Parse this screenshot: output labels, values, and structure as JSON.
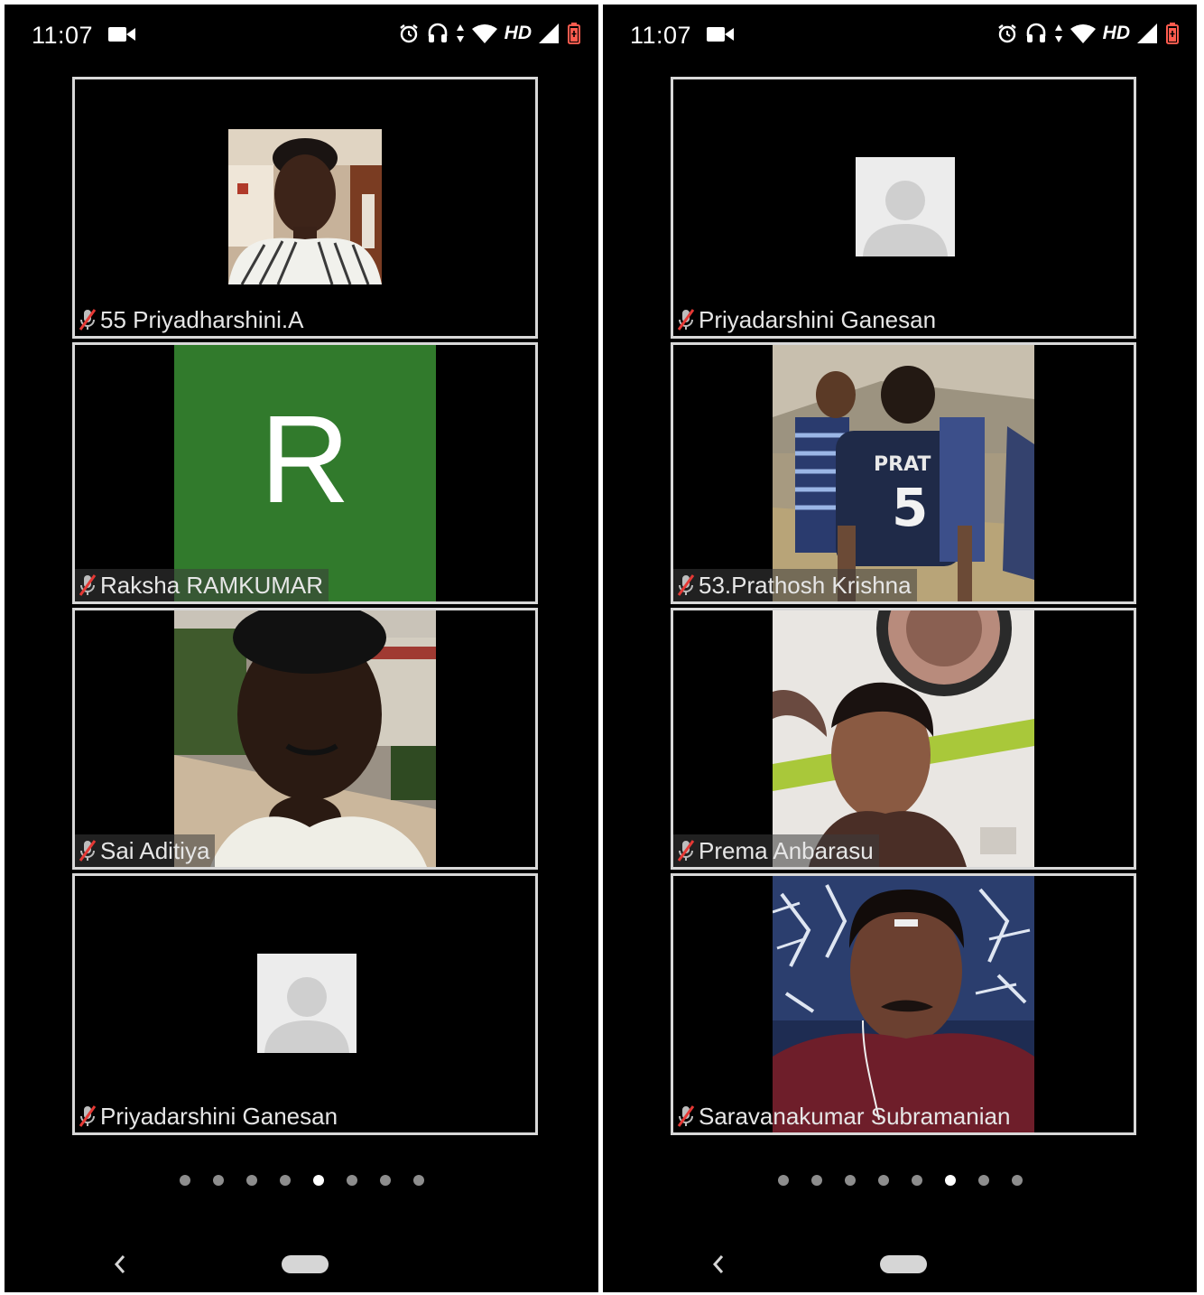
{
  "colors": {
    "screen": "#000000",
    "tile_border": "#d8d8d8",
    "initial_avatar": "#317a2c",
    "page_dot": "#8d8d8d",
    "page_dot_active": "#ffffff",
    "mic_muted": "#e53935"
  },
  "left_phone": {
    "status": {
      "time": "11:07",
      "network": "HD",
      "icons": [
        "video-camera-icon",
        "alarm-icon",
        "headset-icon",
        "data-arrows-icon",
        "wifi-icon",
        "signal-icon",
        "battery-icon"
      ]
    },
    "tiles": [
      {
        "name": "55 Priyadharshini.A",
        "video": "camera-feed"
      },
      {
        "name": "Raksha RAMKUMAR",
        "avatar_initial": "R"
      },
      {
        "name": "Sai Aditiya",
        "video": "camera-feed"
      },
      {
        "name": "Priyadarshini Ganesan",
        "avatar": "default-avatar"
      }
    ],
    "pager": {
      "count": 8,
      "active_index": 4
    }
  },
  "right_phone": {
    "status": {
      "time": "11:07",
      "network": "HD",
      "icons": [
        "video-camera-icon",
        "alarm-icon",
        "headset-icon",
        "data-arrows-icon",
        "wifi-icon",
        "signal-icon",
        "battery-icon"
      ]
    },
    "tiles": [
      {
        "name": "Priyadarshini Ganesan",
        "avatar": "default-avatar"
      },
      {
        "name": "53.Prathosh Krishna",
        "video": "camera-feed",
        "jersey_text": "PRAT",
        "jersey_number": "5"
      },
      {
        "name": "Prema Anbarasu",
        "video": "camera-feed"
      },
      {
        "name": "Saravanakumar Subramanian",
        "video": "camera-feed"
      }
    ],
    "pager": {
      "count": 8,
      "active_index": 5
    }
  },
  "navbar": {
    "icons": [
      "back-chevron-icon",
      "home-pill-icon"
    ]
  }
}
